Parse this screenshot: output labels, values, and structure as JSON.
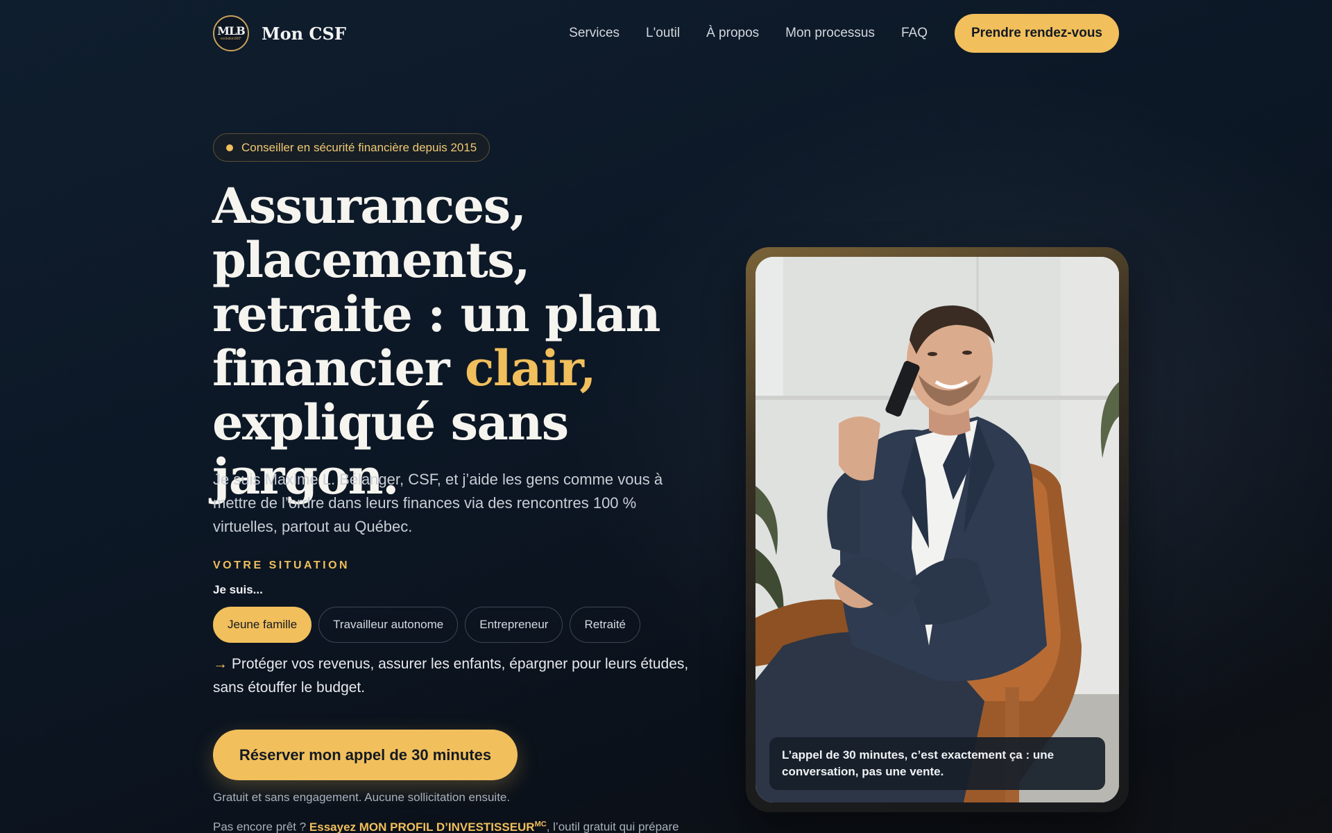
{
  "nav": {
    "logo_mark": "MLB",
    "logo_sub": "evolution360°",
    "brand": "Mon CSF",
    "links": [
      "Services",
      "L'outil",
      "À propos",
      "Mon processus",
      "FAQ"
    ],
    "cta": "Prendre rendez-vous"
  },
  "hero": {
    "badge": "Conseiller en sécurité financière depuis 2015",
    "headline_part1": "Assurances, placements, retraite : un plan financier",
    "headline_accent": "clair,",
    "headline_part2": "expliqué sans jargon.",
    "intro": "Je suis Maxime L. Bélanger, CSF, et j’aide les gens comme vous à mettre de l’ordre dans leurs finances via des rencontres 100 % virtuelles, partout au Québec.",
    "situation_label": "VOTRE SITUATION",
    "situation_prompt": "Je suis...",
    "situations": [
      "Jeune famille",
      "Travailleur autonome",
      "Entrepreneur",
      "Retraité"
    ],
    "selected_situation": "Jeune famille",
    "situation_arrow": "→",
    "situation_description": "Protéger vos revenus, assurer les enfants, épargner pour leurs études, sans étouffer le budget.",
    "primary_cta": "Réserver mon appel de 30 minutes",
    "fine_print": "Gratuit et sans engagement. Aucune sollicitation ensuite.",
    "teaser_prefix": "Pas encore prêt ? ",
    "teaser_link": "Essayez MON PROFIL D’INVESTISSEUR",
    "teaser_sup": "MC",
    "teaser_suffix": ", l’outil gratuit qui prépare"
  },
  "photo": {
    "caption": "L’appel de 30 minutes, c’est exactement ça : une conversation, pas une vente."
  },
  "colors": {
    "accent": "#f1bf5c",
    "background": "#0c1725",
    "text": "#e6e9ef"
  }
}
